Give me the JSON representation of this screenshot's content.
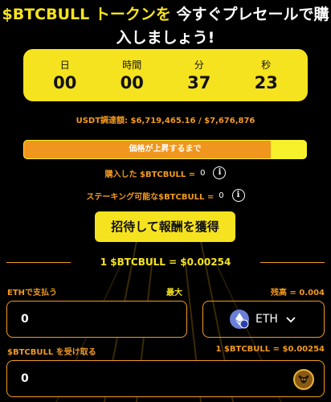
{
  "headline": {
    "part1_yellow": "$BTCBULL トークンを",
    "part1_white": "今すぐプレセールで購",
    "part2": "入しましょう!"
  },
  "countdown": [
    {
      "label": "日",
      "value": "00"
    },
    {
      "label": "時間",
      "value": "00"
    },
    {
      "label": "分",
      "value": "37"
    },
    {
      "label": "秒",
      "value": "23"
    }
  ],
  "raised_text": "USDT調達額: $6,719,465.16 / $7,676,876",
  "progress": {
    "label": "価格が上昇するまで",
    "fraction": 0.875
  },
  "purchased": {
    "label": "購入した $BTCBULL =",
    "value": "0"
  },
  "stakeable": {
    "label": "ステーキング可能な$BTCBULL =",
    "value": "0"
  },
  "invite_button": "招待して報酬を獲得",
  "rate_text": "1 $BTCBULL = $0.00254",
  "pay": {
    "label": "ETHで支払う",
    "max_label": "最大",
    "balance_label": "残高 = 0.004",
    "value": "0"
  },
  "currency_select": {
    "symbol": "ETH",
    "icon": "eth-icon"
  },
  "receive": {
    "label": "$BTCBULL を受け取る",
    "rate": "1 $BTCBULL = $0.00254",
    "value": "0",
    "icon": "btcbull-token-icon"
  },
  "colors": {
    "yellow": "#f6e31f",
    "orange": "#f39a1e",
    "background": "#000000"
  }
}
